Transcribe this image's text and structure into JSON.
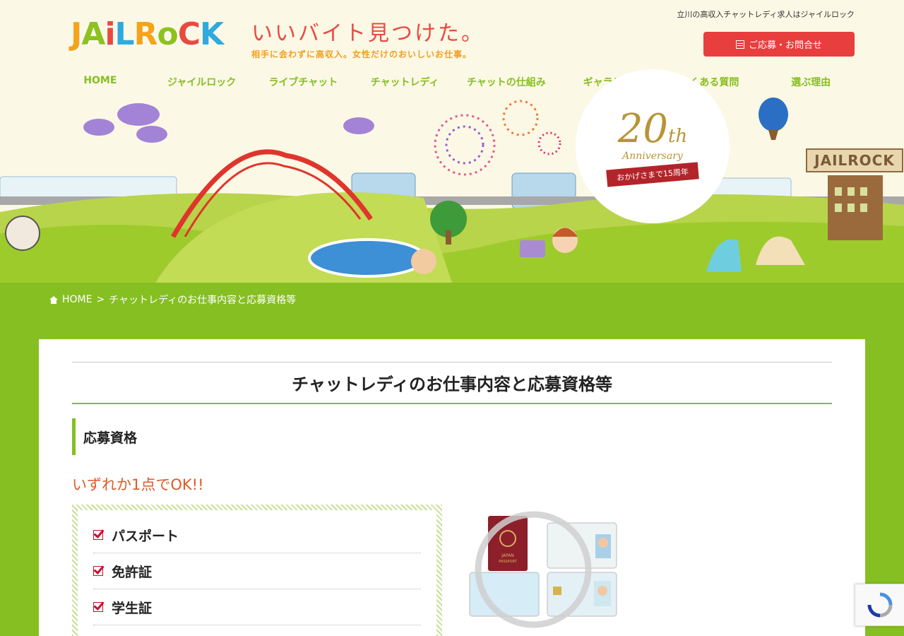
{
  "header": {
    "logo_letters": [
      "J",
      "A",
      "i",
      "L",
      "R",
      "o",
      "C",
      "K"
    ],
    "logo_colors": [
      "#f5a31a",
      "#8dc21f",
      "#e94a3f",
      "#2eaadc",
      "#f5a31a",
      "#8dc21f",
      "#e94a3f",
      "#2eaadc"
    ],
    "tagline_main": "いいバイト見つけた。",
    "tagline_sub": "相手に会わずに高収入。女性だけのおいしいお仕事。",
    "top_note": "立川の高収入チャットレディ求人はジャイルロック",
    "cta_label": "ご応募・お問合せ"
  },
  "nav": {
    "items": [
      "HOME",
      "ジャイルロック",
      "ライブチャット",
      "チャットレディ",
      "チャットの仕組み",
      "ギャラリー",
      "よくある質問",
      "選ぶ理由"
    ]
  },
  "hero": {
    "badge_number": "20",
    "badge_suffix": "th",
    "badge_label": "Anniversary",
    "badge_ribbon": "おかげさまで15周年",
    "sign_text": "JAILROCK"
  },
  "breadcrumb": {
    "home": "HOME",
    "separator": ">",
    "current": "チャットレディのお仕事内容と応募資格等"
  },
  "main": {
    "page_title": "チャットレディのお仕事内容と応募資格等",
    "section_heading": "応募資格",
    "ok_text": "いずれか1点でOK!!",
    "id_list": [
      "パスポート",
      "免許証",
      "学生証"
    ],
    "id_image_labels": [
      "JAPAN",
      "PASSPORT"
    ]
  },
  "colors": {
    "brand_green": "#86bf22",
    "cta_red": "#e83e3e",
    "accent_orange": "#e05a28",
    "gold": "#b89436"
  }
}
